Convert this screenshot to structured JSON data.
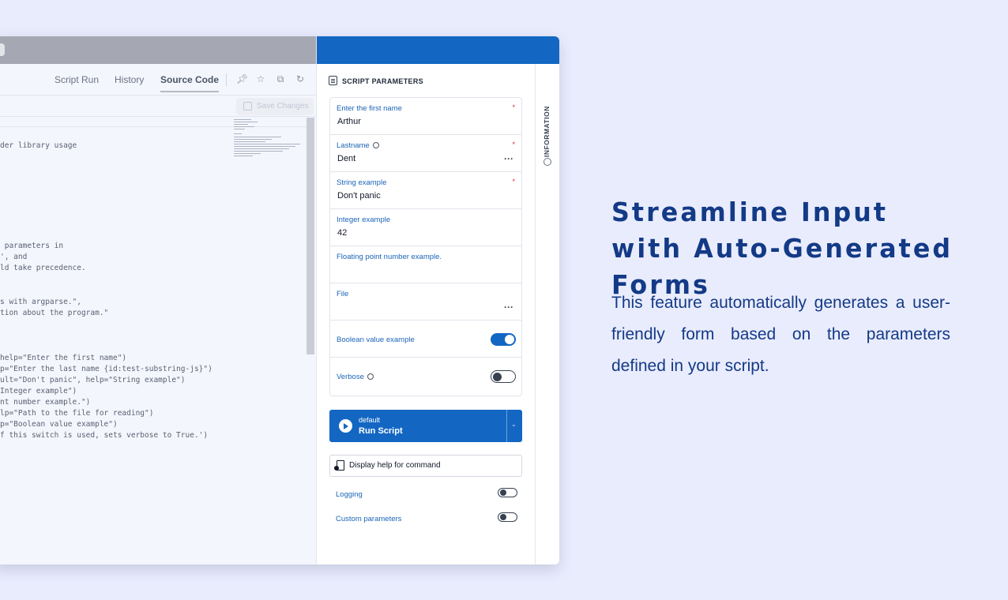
{
  "app": {
    "tabs": [
      {
        "label": "Script Run"
      },
      {
        "label": "History"
      },
      {
        "label": "Source Code",
        "active": true
      }
    ],
    "toolbar_icons": [
      "pin-icon",
      "star-icon",
      "external-link-icon",
      "refresh-icon"
    ],
    "save_label": "Save Changes",
    "code_lines": [
      "der library usage",
      " parameters in",
      "', and",
      "ld take precedence.",
      "s with argparse.\",",
      "tion about the program.\"",
      "help=\"Enter the first name\")",
      "p=\"Enter the last name {id:test-substring-js}\")",
      "ult=\"Don't panic\", help=\"String example\")",
      "Integer example\")",
      "nt number example.\")",
      "lp=\"Path to the file for reading\")",
      "p=\"Boolean value example\")",
      "f this switch is used, sets verbose to True.')"
    ]
  },
  "panel": {
    "title": "SCRIPT PARAMETERS",
    "side_tab": "INFORMATION",
    "fields": [
      {
        "label": "Enter the first name",
        "value": "Arthur",
        "required": true
      },
      {
        "label": "Lastname",
        "value": "Dent",
        "required": true,
        "info": true,
        "more": true
      },
      {
        "label": "String example",
        "value": "Don't panic",
        "required": true
      },
      {
        "label": "Integer example",
        "value": "42"
      },
      {
        "label": "Floating point number example.",
        "value": ""
      },
      {
        "label": "File",
        "value": "",
        "more": true
      },
      {
        "label": "Boolean value example",
        "toggle": "on"
      },
      {
        "label": "Verbose",
        "toggle": "off",
        "info": true
      }
    ],
    "run": {
      "sub": "default",
      "label": "Run Script"
    },
    "help_label": "Display help for command",
    "options": [
      {
        "label": "Logging",
        "toggle": "off"
      },
      {
        "label": "Custom parameters",
        "toggle": "off"
      }
    ],
    "required_mark": "*",
    "more_mark": "···"
  },
  "marketing": {
    "headline": "Streamline Input with Auto-Generated Forms",
    "description": "This feature automatically generates a user-friendly form based on the parameters defined in your script."
  },
  "colors": {
    "background": "#e9ecfd",
    "accent": "#1367c3",
    "headline": "#133a86",
    "required": "#d9263a"
  }
}
